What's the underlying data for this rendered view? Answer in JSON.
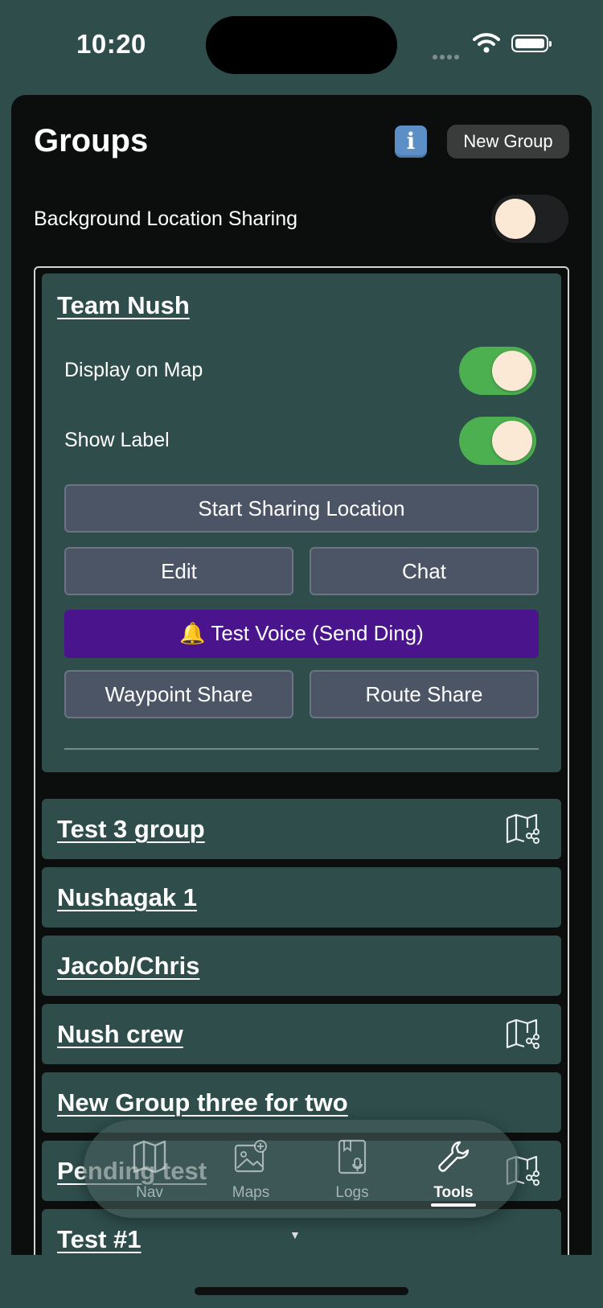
{
  "status": {
    "time": "10:20"
  },
  "header": {
    "title": "Groups",
    "info_label": "i",
    "new_group_label": "New Group"
  },
  "background_sharing": {
    "label": "Background Location Sharing",
    "enabled": false
  },
  "expanded_group": {
    "name": "Team Nush",
    "display_on_map_label": "Display on Map",
    "display_on_map": true,
    "show_label_label": "Show Label",
    "show_label": true,
    "start_sharing_label": "Start Sharing Location",
    "edit_label": "Edit",
    "chat_label": "Chat",
    "test_voice_label": "🔔 Test Voice (Send Ding)",
    "waypoint_share_label": "Waypoint Share",
    "route_share_label": "Route Share"
  },
  "groups": [
    {
      "name": "Test 3 group",
      "shared_map_icon": true
    },
    {
      "name": "Nushagak 1",
      "shared_map_icon": false
    },
    {
      "name": "Jacob/Chris",
      "shared_map_icon": false
    },
    {
      "name": "Nush crew",
      "shared_map_icon": true
    },
    {
      "name": "New Group three for two",
      "shared_map_icon": false
    },
    {
      "name": "Pending test",
      "shared_map_icon": true
    },
    {
      "name": "Test #1",
      "shared_map_icon": false
    }
  ],
  "tabbar": {
    "tabs": [
      {
        "label": "Nav",
        "icon": "map-icon"
      },
      {
        "label": "Maps",
        "icon": "image-add-icon"
      },
      {
        "label": "Logs",
        "icon": "logbook-icon"
      },
      {
        "label": "Tools",
        "icon": "wrench-icon",
        "active": true
      }
    ]
  },
  "colors": {
    "accent_green": "#4caf50",
    "voice_purple": "#4a148c",
    "card_bg": "#2e4d4b",
    "button_bg": "#4b5566"
  }
}
